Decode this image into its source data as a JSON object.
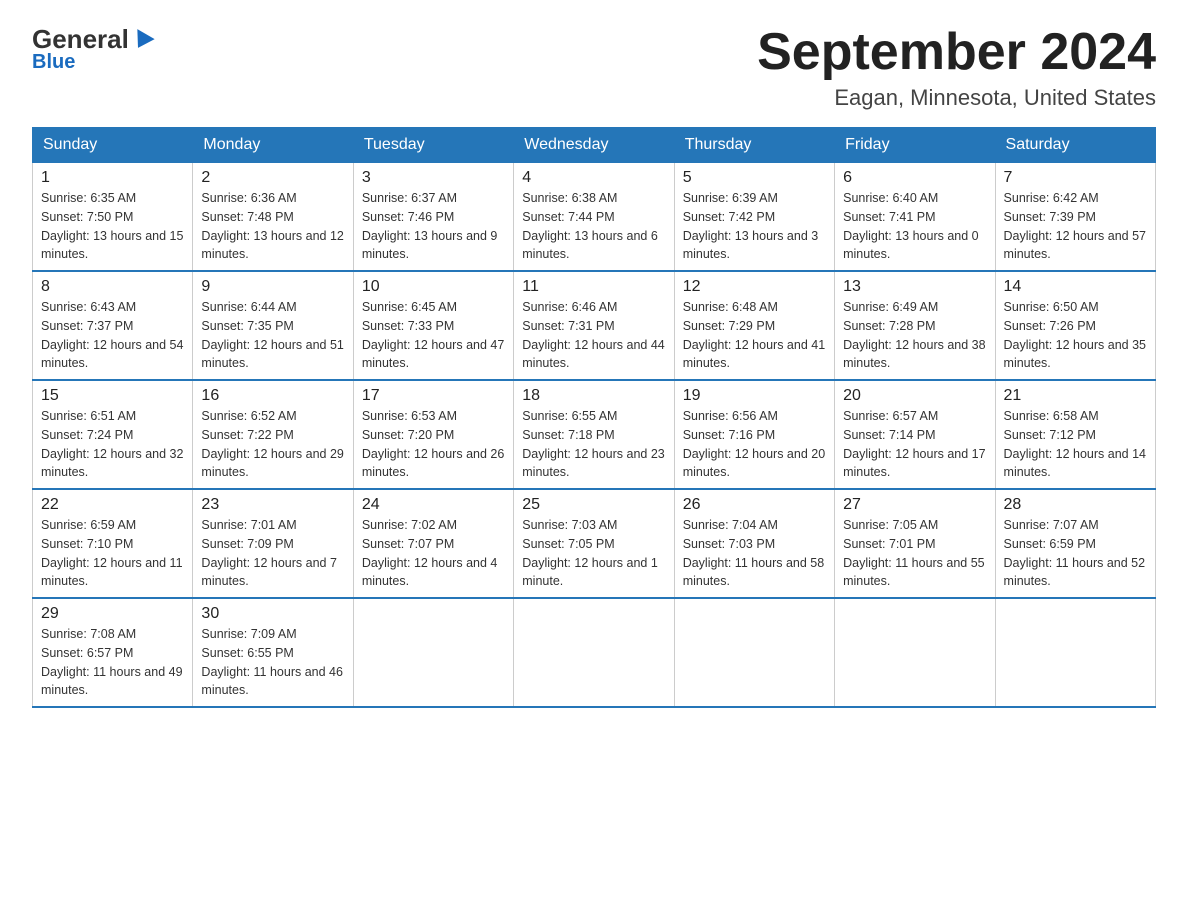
{
  "header": {
    "logo_general": "General",
    "logo_blue": "Blue",
    "month_title": "September 2024",
    "location": "Eagan, Minnesota, United States"
  },
  "days_of_week": [
    "Sunday",
    "Monday",
    "Tuesday",
    "Wednesday",
    "Thursday",
    "Friday",
    "Saturday"
  ],
  "weeks": [
    [
      {
        "day": "1",
        "sunrise": "6:35 AM",
        "sunset": "7:50 PM",
        "daylight": "13 hours and 15 minutes."
      },
      {
        "day": "2",
        "sunrise": "6:36 AM",
        "sunset": "7:48 PM",
        "daylight": "13 hours and 12 minutes."
      },
      {
        "day": "3",
        "sunrise": "6:37 AM",
        "sunset": "7:46 PM",
        "daylight": "13 hours and 9 minutes."
      },
      {
        "day": "4",
        "sunrise": "6:38 AM",
        "sunset": "7:44 PM",
        "daylight": "13 hours and 6 minutes."
      },
      {
        "day": "5",
        "sunrise": "6:39 AM",
        "sunset": "7:42 PM",
        "daylight": "13 hours and 3 minutes."
      },
      {
        "day": "6",
        "sunrise": "6:40 AM",
        "sunset": "7:41 PM",
        "daylight": "13 hours and 0 minutes."
      },
      {
        "day": "7",
        "sunrise": "6:42 AM",
        "sunset": "7:39 PM",
        "daylight": "12 hours and 57 minutes."
      }
    ],
    [
      {
        "day": "8",
        "sunrise": "6:43 AM",
        "sunset": "7:37 PM",
        "daylight": "12 hours and 54 minutes."
      },
      {
        "day": "9",
        "sunrise": "6:44 AM",
        "sunset": "7:35 PM",
        "daylight": "12 hours and 51 minutes."
      },
      {
        "day": "10",
        "sunrise": "6:45 AM",
        "sunset": "7:33 PM",
        "daylight": "12 hours and 47 minutes."
      },
      {
        "day": "11",
        "sunrise": "6:46 AM",
        "sunset": "7:31 PM",
        "daylight": "12 hours and 44 minutes."
      },
      {
        "day": "12",
        "sunrise": "6:48 AM",
        "sunset": "7:29 PM",
        "daylight": "12 hours and 41 minutes."
      },
      {
        "day": "13",
        "sunrise": "6:49 AM",
        "sunset": "7:28 PM",
        "daylight": "12 hours and 38 minutes."
      },
      {
        "day": "14",
        "sunrise": "6:50 AM",
        "sunset": "7:26 PM",
        "daylight": "12 hours and 35 minutes."
      }
    ],
    [
      {
        "day": "15",
        "sunrise": "6:51 AM",
        "sunset": "7:24 PM",
        "daylight": "12 hours and 32 minutes."
      },
      {
        "day": "16",
        "sunrise": "6:52 AM",
        "sunset": "7:22 PM",
        "daylight": "12 hours and 29 minutes."
      },
      {
        "day": "17",
        "sunrise": "6:53 AM",
        "sunset": "7:20 PM",
        "daylight": "12 hours and 26 minutes."
      },
      {
        "day": "18",
        "sunrise": "6:55 AM",
        "sunset": "7:18 PM",
        "daylight": "12 hours and 23 minutes."
      },
      {
        "day": "19",
        "sunrise": "6:56 AM",
        "sunset": "7:16 PM",
        "daylight": "12 hours and 20 minutes."
      },
      {
        "day": "20",
        "sunrise": "6:57 AM",
        "sunset": "7:14 PM",
        "daylight": "12 hours and 17 minutes."
      },
      {
        "day": "21",
        "sunrise": "6:58 AM",
        "sunset": "7:12 PM",
        "daylight": "12 hours and 14 minutes."
      }
    ],
    [
      {
        "day": "22",
        "sunrise": "6:59 AM",
        "sunset": "7:10 PM",
        "daylight": "12 hours and 11 minutes."
      },
      {
        "day": "23",
        "sunrise": "7:01 AM",
        "sunset": "7:09 PM",
        "daylight": "12 hours and 7 minutes."
      },
      {
        "day": "24",
        "sunrise": "7:02 AM",
        "sunset": "7:07 PM",
        "daylight": "12 hours and 4 minutes."
      },
      {
        "day": "25",
        "sunrise": "7:03 AM",
        "sunset": "7:05 PM",
        "daylight": "12 hours and 1 minute."
      },
      {
        "day": "26",
        "sunrise": "7:04 AM",
        "sunset": "7:03 PM",
        "daylight": "11 hours and 58 minutes."
      },
      {
        "day": "27",
        "sunrise": "7:05 AM",
        "sunset": "7:01 PM",
        "daylight": "11 hours and 55 minutes."
      },
      {
        "day": "28",
        "sunrise": "7:07 AM",
        "sunset": "6:59 PM",
        "daylight": "11 hours and 52 minutes."
      }
    ],
    [
      {
        "day": "29",
        "sunrise": "7:08 AM",
        "sunset": "6:57 PM",
        "daylight": "11 hours and 49 minutes."
      },
      {
        "day": "30",
        "sunrise": "7:09 AM",
        "sunset": "6:55 PM",
        "daylight": "11 hours and 46 minutes."
      },
      null,
      null,
      null,
      null,
      null
    ]
  ],
  "labels": {
    "sunrise_prefix": "Sunrise: ",
    "sunset_prefix": "Sunset: ",
    "daylight_prefix": "Daylight: "
  }
}
